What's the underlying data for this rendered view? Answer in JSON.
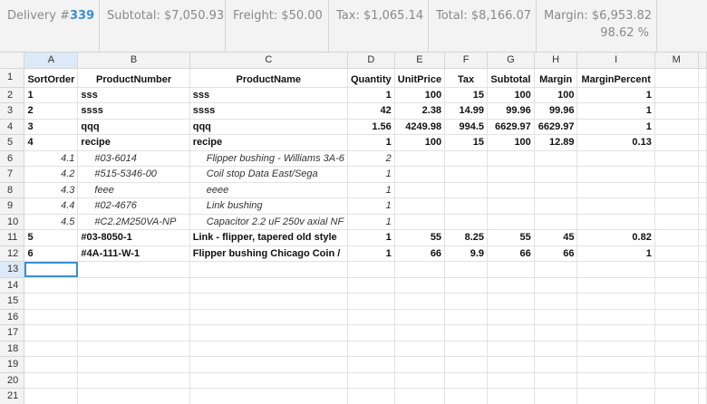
{
  "summary": {
    "delivery_label": "Delivery #",
    "delivery_number": "339",
    "subtotal": "Subtotal: $7,050.93",
    "freight": "Freight: $50.00",
    "tax": "Tax: $1,065.14",
    "total": "Total: $8,166.07",
    "margin": "Margin: $6,953.82",
    "margin_percent": "98.62 %"
  },
  "columns": [
    "A",
    "B",
    "C",
    "D",
    "E",
    "F",
    "G",
    "H",
    "I",
    "M"
  ],
  "header_row": {
    "row": "1",
    "cells": [
      "SortOrder",
      "ProductNumber",
      "ProductName",
      "Quantity",
      "UnitPrice",
      "Tax",
      "Subtotal",
      "Margin",
      "MarginPercent",
      ""
    ]
  },
  "rows": [
    {
      "row": "2",
      "style": "bold",
      "cells": [
        "1",
        "sss",
        "sss",
        "1",
        "100",
        "15",
        "100",
        "100",
        "1"
      ]
    },
    {
      "row": "3",
      "style": "bold",
      "cells": [
        "2",
        "ssss",
        "ssss",
        "42",
        "2.38",
        "14.99",
        "99.96",
        "99.96",
        "1"
      ]
    },
    {
      "row": "4",
      "style": "bold",
      "cells": [
        "3",
        "qqq",
        "qqq",
        "1.56",
        "4249.98",
        "994.5",
        "6629.97",
        "6629.97",
        "1"
      ]
    },
    {
      "row": "5",
      "style": "bold",
      "cells": [
        "4",
        "recipe",
        "recipe",
        "1",
        "100",
        "15",
        "100",
        "12.89",
        "0.13"
      ]
    },
    {
      "row": "6",
      "style": "italic",
      "cells": [
        "4.1",
        "#03-6014",
        "Flipper bushing - Williams 3A-6",
        "2",
        "",
        "",
        "",
        "",
        ""
      ]
    },
    {
      "row": "7",
      "style": "italic",
      "cells": [
        "4.2",
        "#515-5346-00",
        "Coil stop Data East/Sega",
        "1",
        "",
        "",
        "",
        "",
        ""
      ]
    },
    {
      "row": "8",
      "style": "italic",
      "cells": [
        "4.3",
        "feee",
        "eeee",
        "1",
        "",
        "",
        "",
        "",
        ""
      ]
    },
    {
      "row": "9",
      "style": "italic",
      "cells": [
        "4.4",
        "#02-4676",
        "Link bushing",
        "1",
        "",
        "",
        "",
        "",
        ""
      ]
    },
    {
      "row": "10",
      "style": "italic",
      "cells": [
        "4.5",
        "#C2.2M250VA-NP",
        "Capacitor 2.2 uF 250v axial NF",
        "1",
        "",
        "",
        "",
        "",
        ""
      ]
    },
    {
      "row": "11",
      "style": "bold",
      "cells": [
        "5",
        "#03-8050-1",
        "Link - flipper, tapered old style",
        "1",
        "55",
        "8.25",
        "55",
        "45",
        "0.82"
      ]
    },
    {
      "row": "12",
      "style": "bold",
      "cells": [
        "6",
        "#4A-111-W-1",
        "Flipper bushing Chicago Coin /",
        "1",
        "66",
        "9.9",
        "66",
        "66",
        "1"
      ]
    },
    {
      "row": "13",
      "style": "empty",
      "cells": [
        "",
        "",
        "",
        "",
        "",
        "",
        "",
        "",
        ""
      ]
    },
    {
      "row": "14",
      "style": "empty",
      "cells": [
        "",
        "",
        "",
        "",
        "",
        "",
        "",
        "",
        ""
      ]
    },
    {
      "row": "15",
      "style": "empty",
      "cells": [
        "",
        "",
        "",
        "",
        "",
        "",
        "",
        "",
        ""
      ]
    },
    {
      "row": "16",
      "style": "empty",
      "cells": [
        "",
        "",
        "",
        "",
        "",
        "",
        "",
        "",
        ""
      ]
    },
    {
      "row": "17",
      "style": "empty",
      "cells": [
        "",
        "",
        "",
        "",
        "",
        "",
        "",
        "",
        ""
      ]
    },
    {
      "row": "18",
      "style": "empty",
      "cells": [
        "",
        "",
        "",
        "",
        "",
        "",
        "",
        "",
        ""
      ]
    },
    {
      "row": "19",
      "style": "empty",
      "cells": [
        "",
        "",
        "",
        "",
        "",
        "",
        "",
        "",
        ""
      ]
    },
    {
      "row": "20",
      "style": "empty",
      "cells": [
        "",
        "",
        "",
        "",
        "",
        "",
        "",
        "",
        ""
      ]
    },
    {
      "row": "21",
      "style": "empty",
      "cells": [
        "",
        "",
        "",
        "",
        "",
        "",
        "",
        "",
        ""
      ]
    }
  ],
  "selection": {
    "column": "A",
    "row": "13"
  },
  "colors": {
    "accent": "#3a8fd4",
    "header_bg": "#f3f3f3",
    "selected_header_bg": "#dce9f7",
    "grid_line": "#e2e2e2"
  }
}
